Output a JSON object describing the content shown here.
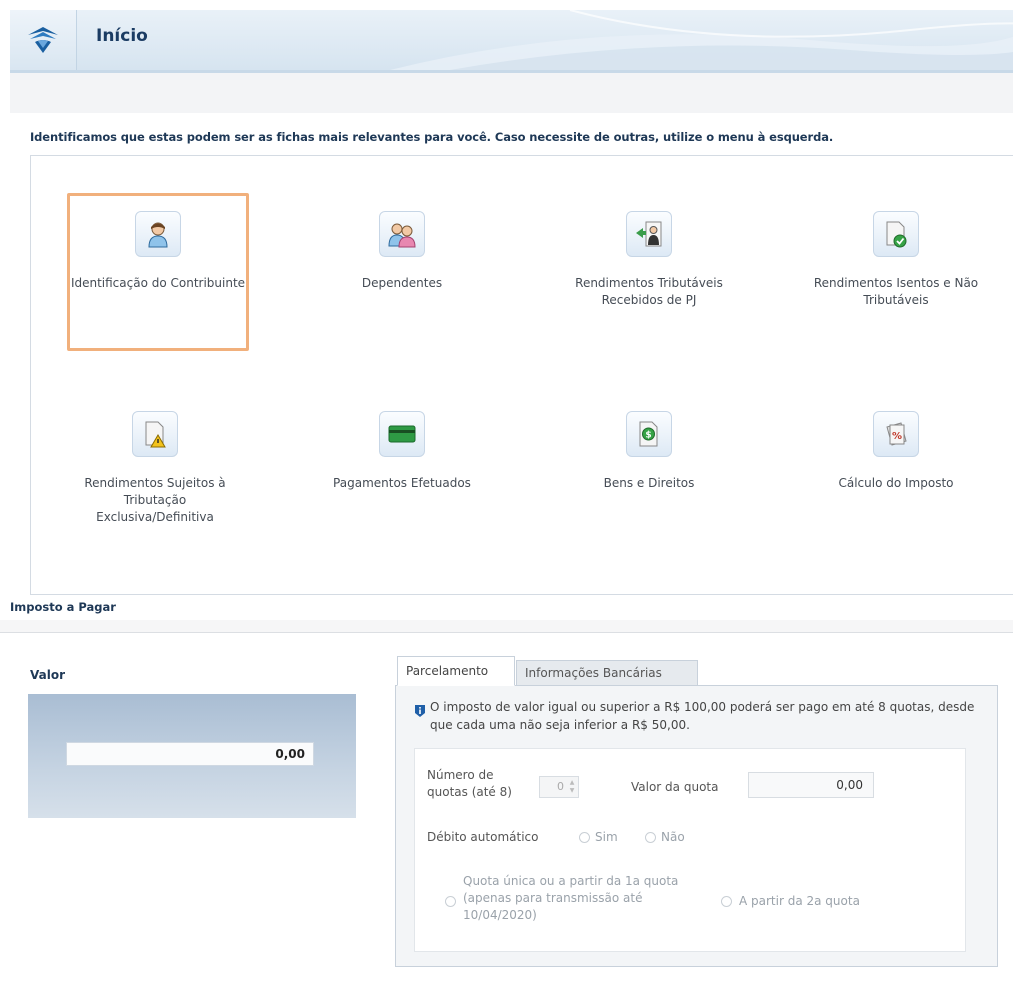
{
  "header": {
    "title": "Início",
    "logo_icon": "receita-federal-logo-icon"
  },
  "notice": "Identificamos que estas podem ser as fichas mais relevantes para você. Caso necessite de outras, utilize o menu à esquerda.",
  "cards": [
    {
      "label": "Identificação do Contribuinte",
      "icon": "person-icon",
      "selected": true
    },
    {
      "label": "Dependentes",
      "icon": "dependents-icon"
    },
    {
      "label": "Rendimentos Tributáveis Recebidos de PJ",
      "icon": "income-pj-icon"
    },
    {
      "label": "Rendimentos Isentos e Não Tributáveis",
      "icon": "exempt-income-icon"
    },
    {
      "label": "Rendimentos Sujeitos à Tributação Exclusiva/Definitiva",
      "icon": "exclusive-tax-icon"
    },
    {
      "label": "Pagamentos Efetuados",
      "icon": "payments-icon"
    },
    {
      "label": "Bens e Direitos",
      "icon": "assets-icon"
    },
    {
      "label": "Cálculo do Imposto",
      "icon": "tax-calc-icon"
    }
  ],
  "imposto": {
    "section_title": "Imposto a Pagar",
    "valor_label": "Valor",
    "valor_value": "0,00"
  },
  "tabs": {
    "parcelamento": "Parcelamento",
    "bancarias": "Informações Bancárias"
  },
  "parcelamento": {
    "info_text": "O imposto de valor igual ou superior a R$ 100,00 poderá ser pago em até 8 quotas, desde que cada uma não seja inferior a R$ 50,00.",
    "num_quotas_label": "Número de quotas (até 8)",
    "num_quotas_value": "0",
    "valor_quota_label": "Valor da quota",
    "valor_quota_value": "0,00",
    "debito_label": "Débito automático",
    "sim_label": "Sim",
    "nao_label": "Não",
    "quota_unica_label": "Quota única ou a partir da 1a quota (apenas para transmissão até 10/04/2020)",
    "a_partir_2a_label": "A partir da 2a quota"
  },
  "colors": {
    "accent": "#1e3856",
    "highlight": "#f1b07c"
  }
}
